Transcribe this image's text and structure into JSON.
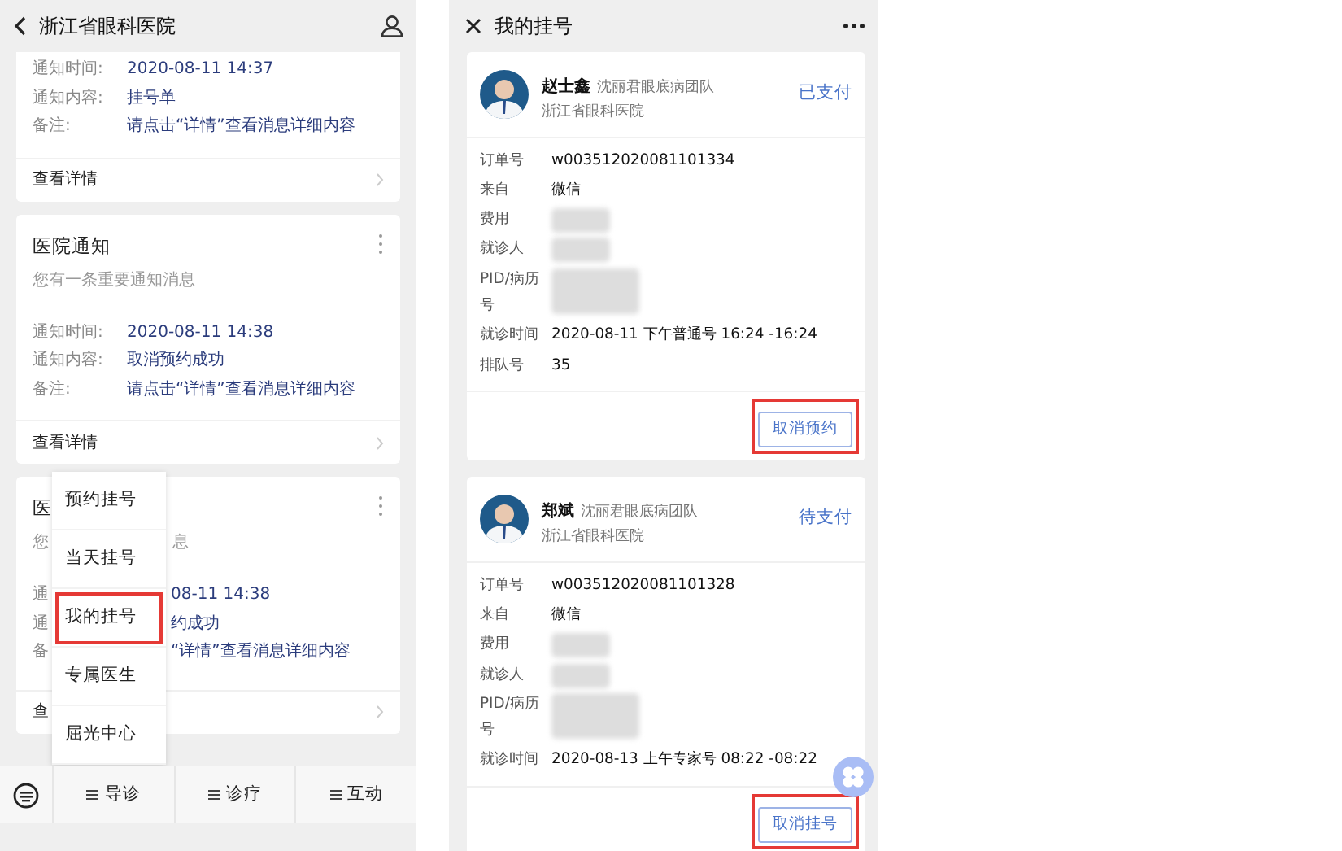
{
  "left_screen": {
    "header": {
      "title": "浙江省眼科医院"
    },
    "cards": [
      {
        "partial_top": true,
        "rows": [
          {
            "label": "通知时间:",
            "value": "2020-08-11 14:37"
          },
          {
            "label": "通知内容:",
            "value": "挂号单"
          },
          {
            "label": "备注:",
            "value": "请点击“详情”查看消息详细内容"
          }
        ],
        "footer": "查看详情"
      },
      {
        "title": "医院通知",
        "subtitle": [
          "您有一条重要通知消息"
        ],
        "rows": [
          {
            "label": "通知时间:",
            "value": "2020-08-11 14:38"
          },
          {
            "label": "通知内容:",
            "value": "取消预约成功"
          },
          {
            "label": "备注:",
            "value": "请点击“详情”查看消息详细内容"
          }
        ],
        "footer": "查看详情"
      },
      {
        "covered": true,
        "title": "医",
        "subtitle": [
          "您",
          "息"
        ],
        "rows": [
          {
            "label": "通",
            "value": "08-11 14:38"
          },
          {
            "label": "通",
            "value": "约成功"
          },
          {
            "label": "备",
            "value": "“详情”查看消息详细内容"
          }
        ],
        "footer": "查"
      }
    ],
    "popup_menu": [
      {
        "label": "预约挂号",
        "highlighted": false
      },
      {
        "label": "当天挂号",
        "highlighted": false
      },
      {
        "label": "我的挂号",
        "highlighted": true
      },
      {
        "label": "专属医生",
        "highlighted": false
      },
      {
        "label": "屈光中心",
        "highlighted": false
      }
    ],
    "bottom_bar": [
      {
        "label": "导诊"
      },
      {
        "label": "诊疗"
      },
      {
        "label": "互动"
      }
    ]
  },
  "right_screen": {
    "header": {
      "title": "我的挂号"
    },
    "orders": [
      {
        "doctor": "赵士鑫",
        "team": "沈丽君眼底病团队",
        "hospital": "浙江省眼科医院",
        "status": "已支付",
        "rows": [
          {
            "kind": "text",
            "label": "订单号",
            "value": "w003512020081101334"
          },
          {
            "kind": "text",
            "label": "来自",
            "value": "微信"
          },
          {
            "kind": "redacted",
            "label": "费用"
          },
          {
            "kind": "redacted",
            "label": "就诊人"
          },
          {
            "kind": "redacted",
            "label": "PID/病历号"
          },
          {
            "kind": "text",
            "label": "就诊时间",
            "value": "2020-08-11 下午普通号 16:24 -16:24"
          },
          {
            "kind": "text",
            "label": "排队号",
            "value": "35"
          }
        ],
        "button": {
          "label": "取消预约",
          "highlighted": true
        }
      },
      {
        "doctor": "郑斌",
        "team": "沈丽君眼底病团队",
        "hospital": "浙江省眼科医院",
        "status": "待支付",
        "rows": [
          {
            "kind": "text",
            "label": "订单号",
            "value": "w003512020081101328"
          },
          {
            "kind": "text",
            "label": "来自",
            "value": "微信"
          },
          {
            "kind": "redacted",
            "label": "费用"
          },
          {
            "kind": "redacted",
            "label": "就诊人"
          },
          {
            "kind": "redacted",
            "label": "PID/病历号"
          },
          {
            "kind": "text",
            "label": "就诊时间",
            "value": "2020-08-13 上午专家号 08:22 -08:22"
          }
        ],
        "button": {
          "label": "取消挂号",
          "highlighted": true
        }
      }
    ]
  }
}
